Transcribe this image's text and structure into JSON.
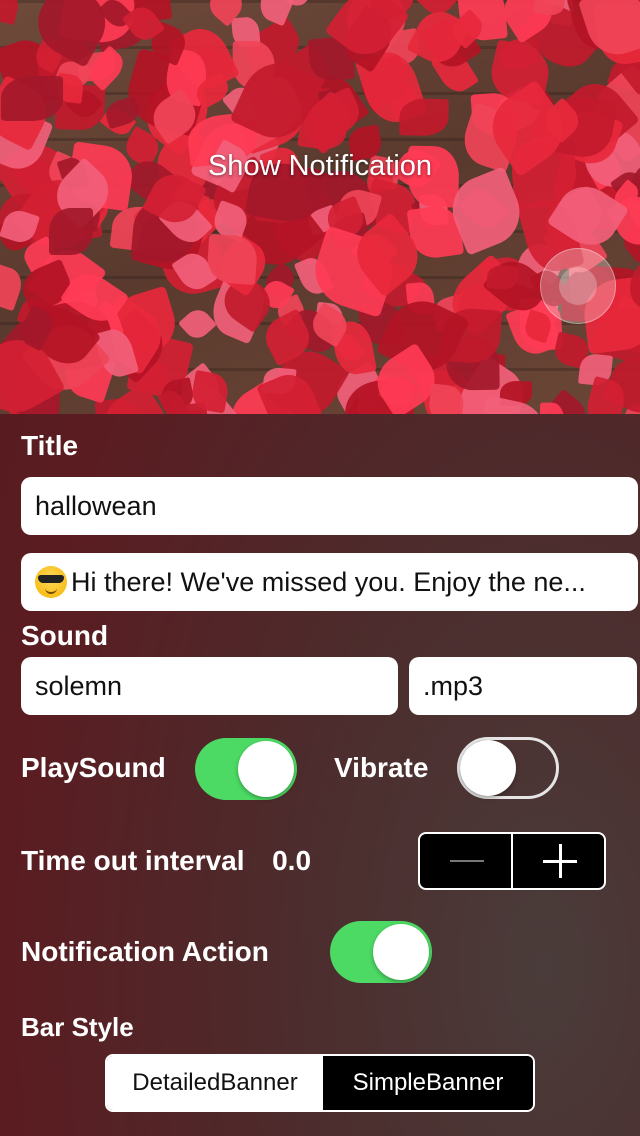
{
  "hero": {
    "title": "Show Notification"
  },
  "title_section": {
    "label": "Title",
    "title_value": "hallowean",
    "body_value": "Hi there! We've missed you. Enjoy the ne..."
  },
  "sound_section": {
    "label": "Sound",
    "name_value": "solemn",
    "extension_value": ".mp3"
  },
  "toggles": {
    "play_sound_label": "PlaySound",
    "play_sound_on": true,
    "vibrate_label": "Vibrate",
    "vibrate_on": false,
    "notification_action_label": "Notification Action",
    "notification_action_on": true
  },
  "timeout": {
    "label": "Time out interval",
    "value": "0.0",
    "decrement_icon": "minus-icon",
    "increment_icon": "plus-icon"
  },
  "bar_style": {
    "label": "Bar Style",
    "options": [
      "DetailedBanner",
      "SimpleBanner"
    ],
    "selected": "SimpleBanner"
  },
  "colors": {
    "toggle_on": "#4cd964",
    "leaf_red": "#e8283c"
  }
}
